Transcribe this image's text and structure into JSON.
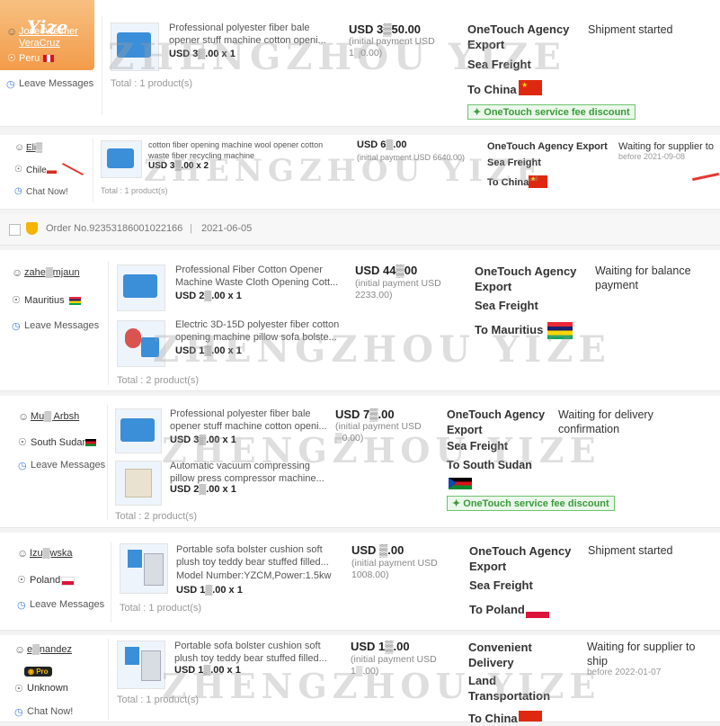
{
  "watermark": "ZHENGZHOU YIZE",
  "logo_text": "Yize",
  "orders": [
    {
      "buyer": "Jose Avelmer VeraCruz",
      "location": "Peru",
      "action": "Leave Messages",
      "products": [
        {
          "title": "Professional polyester fiber bale opener stuff machine cotton openi...",
          "price": "USD 3▒.00 x 1"
        }
      ],
      "total": "Total : 1 product(s)",
      "amount": "USD 3▒50.00",
      "initial_payment": "(initial payment USD 1▒0.00)",
      "shipping": [
        "OneTouch Agency Export",
        "Sea Freight",
        "To China"
      ],
      "badge": "OneTouch service fee discount",
      "status": "Shipment started"
    },
    {
      "buyer": "Eli▒",
      "location": "Chile",
      "action": "Chat Now!",
      "products": [
        {
          "title": "cotton fiber opening machine wool opener cotton waste fiber recycling machine",
          "price": "USD 3▒.00 x 2"
        }
      ],
      "total": "Total : 1 product(s)",
      "amount": "USD 6▒.00",
      "initial_payment": "(initial payment USD 6640.00)",
      "shipping": [
        "OneTouch Agency Export",
        "Sea Freight",
        "To China"
      ],
      "status": "Waiting for supplier to",
      "status_sub": "before 2021-09-08"
    },
    {
      "buyer": "zahe▒mjaun",
      "location": "Mauritius",
      "action": "Leave Messages",
      "products": [
        {
          "title": "Professional Fiber Cotton Opener Machine Waste Cloth Opening Cott...",
          "price": "USD 2▒.00 x 1"
        },
        {
          "title": "Electric 3D-15D polyester fiber cotton opening machine pillow sofa bolste...",
          "price": "USD 1▒.00 x 1"
        }
      ],
      "total": "Total : 2 product(s)",
      "amount": "USD 44▒00",
      "initial_payment": "(initial payment USD 2233.00)",
      "shipping": [
        "OneTouch Agency Export",
        "Sea Freight",
        "To Mauritius"
      ],
      "status": "Waiting for balance payment"
    },
    {
      "buyer": "Mu▒ Arbsh",
      "location": "South Sudan",
      "action": "Leave Messages",
      "products": [
        {
          "title": "Professional polyester fiber bale opener stuff machine cotton openi...",
          "price": "USD 3▒.00 x 1"
        },
        {
          "title": "Automatic vacuum compressing pillow press compressor machine...",
          "price": "USD 2▒.00 x 1"
        }
      ],
      "total": "Total : 2 product(s)",
      "amount": "USD 7▒.00",
      "initial_payment": "(initial payment USD ▒0.00)",
      "shipping": [
        "OneTouch Agency Export",
        "Sea Freight",
        "To South Sudan"
      ],
      "badge": "OneTouch service fee discount",
      "status": "Waiting for delivery confirmation"
    },
    {
      "buyer": "Izu▒wska",
      "location": "Poland",
      "action": "Leave Messages",
      "products": [
        {
          "title": "Portable sofa bolster cushion soft plush toy teddy bear stuffed filled...",
          "model": "Model Number:YZCM,Power:1.5kw",
          "price": "USD 1▒.00 x 1"
        }
      ],
      "total": "Total : 1 product(s)",
      "amount": "USD ▒.00",
      "initial_payment": "(initial payment USD 1008.00)",
      "shipping": [
        "OneTouch Agency Export",
        "Sea Freight",
        "To Poland"
      ],
      "status": "Shipment started"
    },
    {
      "buyer": "e▒nandez",
      "pro_label": "Pro",
      "location": "Unknown",
      "action": "Chat Now!",
      "products": [
        {
          "title": "Portable sofa bolster cushion soft plush toy teddy bear stuffed filled...",
          "price": "USD 1▒.00 x 1"
        }
      ],
      "total": "Total : 1 product(s)",
      "amount": "USD 1▒.00",
      "initial_payment": "(initial payment USD 1▒.00)",
      "shipping": [
        "Convenient Delivery",
        "Land Transportation",
        "To China"
      ],
      "status": "Waiting for supplier to ship",
      "status_sub": "before 2022-01-07"
    }
  ],
  "order_header": {
    "order_no": "Order No.923531860010221​66",
    "date": "2021-06-05",
    "separator": "|"
  }
}
